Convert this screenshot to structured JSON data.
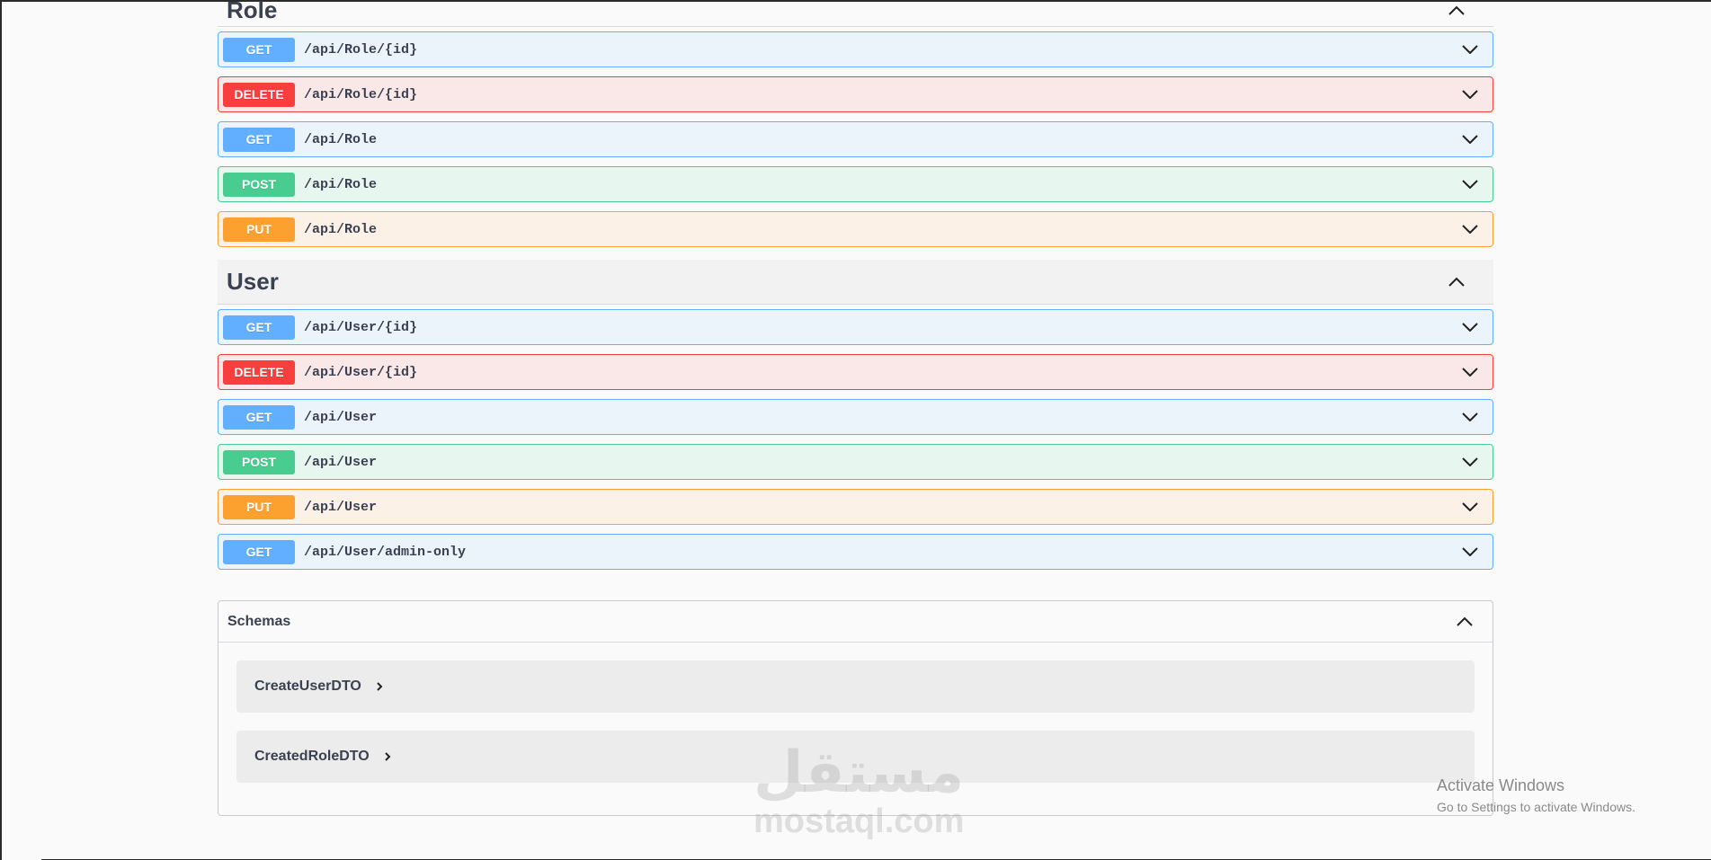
{
  "tags": [
    {
      "name": "Role",
      "operations": [
        {
          "method": "GET",
          "path": "/api/Role/{id}"
        },
        {
          "method": "DELETE",
          "path": "/api/Role/{id}"
        },
        {
          "method": "GET",
          "path": "/api/Role"
        },
        {
          "method": "POST",
          "path": "/api/Role"
        },
        {
          "method": "PUT",
          "path": "/api/Role"
        }
      ]
    },
    {
      "name": "User",
      "operations": [
        {
          "method": "GET",
          "path": "/api/User/{id}"
        },
        {
          "method": "DELETE",
          "path": "/api/User/{id}"
        },
        {
          "method": "GET",
          "path": "/api/User"
        },
        {
          "method": "POST",
          "path": "/api/User"
        },
        {
          "method": "PUT",
          "path": "/api/User"
        },
        {
          "method": "GET",
          "path": "/api/User/admin-only"
        }
      ]
    }
  ],
  "schemas": {
    "title": "Schemas",
    "items": [
      "CreateUserDTO",
      "CreatedRoleDTO"
    ]
  },
  "watermark": {
    "arabic": "مستقل",
    "latin": "mostaql.com"
  },
  "activate_windows": {
    "line1": "Activate Windows",
    "line2": "Go to Settings to activate Windows."
  },
  "colors": {
    "get": "#61affe",
    "delete": "#f93e3e",
    "post": "#49cc90",
    "put": "#fca130"
  }
}
